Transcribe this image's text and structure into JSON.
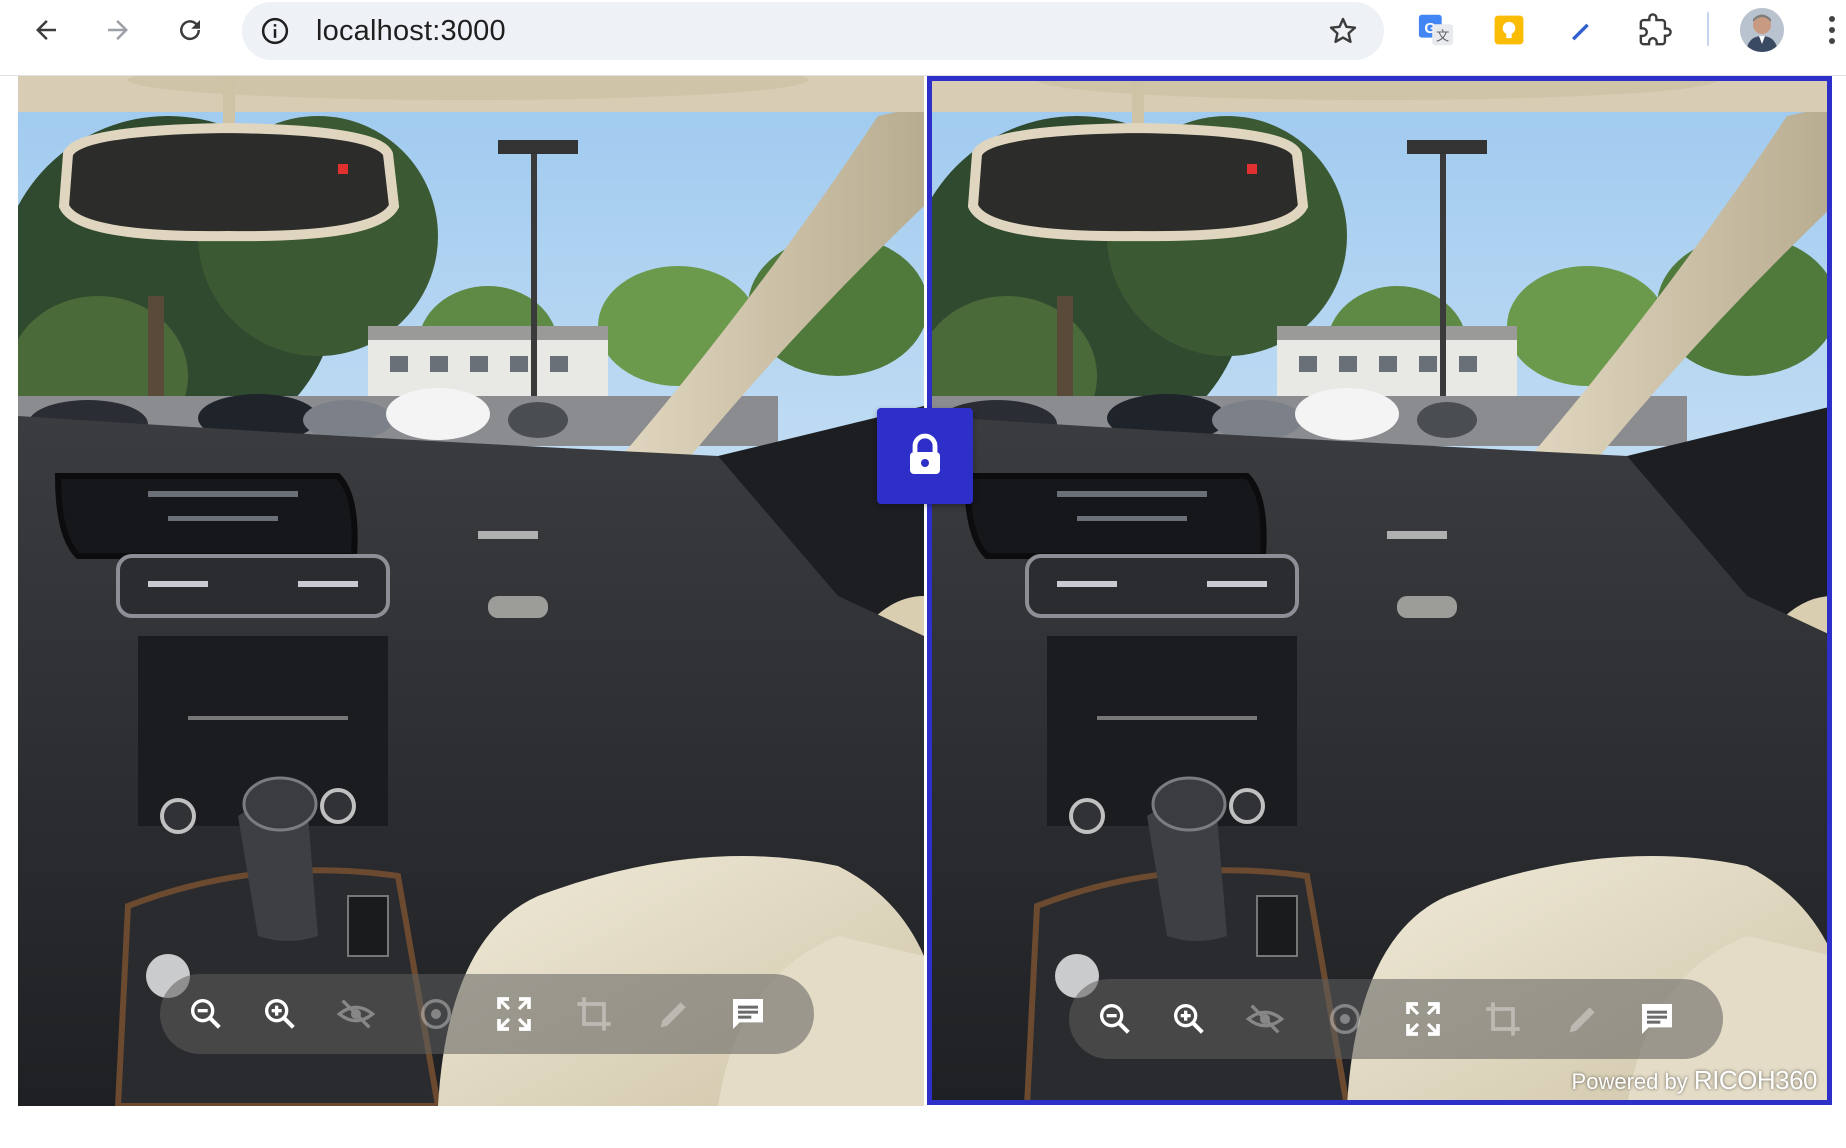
{
  "browser": {
    "url": "localhost:3000",
    "icons": {
      "back": "arrow-back-icon",
      "forward": "arrow-forward-icon",
      "reload": "reload-icon",
      "site_info": "info-icon",
      "bookmark": "star-icon",
      "translate": "google-translate-icon",
      "keep": "google-keep-icon",
      "pen": "pen-extension-icon",
      "extensions": "puzzle-icon",
      "menu": "kebab-menu-icon"
    }
  },
  "viewers": {
    "left": {
      "tools": [
        "zoom-out",
        "zoom-in",
        "hide",
        "hotspot",
        "fullscreen",
        "crop",
        "markup",
        "comment"
      ]
    },
    "right": {
      "tools": [
        "zoom-out",
        "zoom-in",
        "hide",
        "hotspot",
        "fullscreen",
        "crop",
        "markup",
        "comment"
      ],
      "powered_prefix": "Powered by",
      "powered_brand": "RICOH360"
    }
  },
  "sync_lock": {
    "state": "locked",
    "icon": "lock-icon"
  },
  "colors": {
    "accent": "#2e2ec9",
    "toolbar_bg": "#5f5f5f"
  }
}
